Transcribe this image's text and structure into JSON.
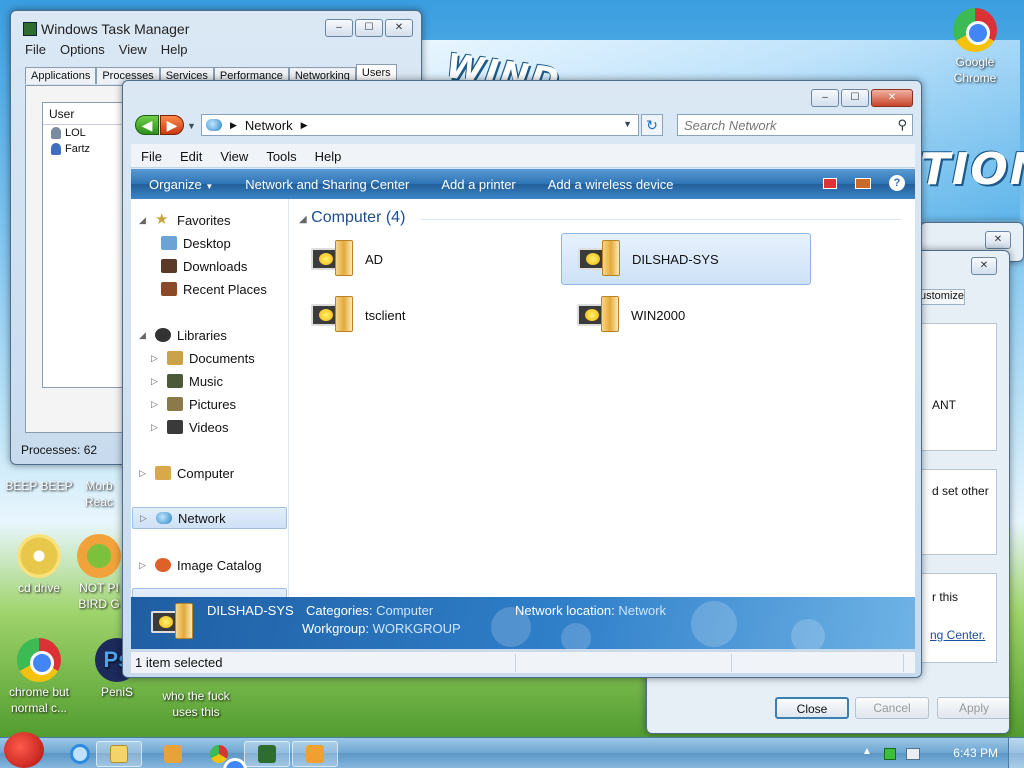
{
  "desktop": {
    "banner": {
      "word1": "WIND",
      "word2": "TION"
    },
    "icons": [
      {
        "label": "Google Chrome"
      },
      {
        "label": "BEEP BEEP"
      },
      {
        "label": "Morb Reac"
      },
      {
        "label": "cd drive"
      },
      {
        "label": "NOT PI BIRD G"
      },
      {
        "label": "chrome but normal c..."
      },
      {
        "label": "PeniS"
      },
      {
        "label": "who the fuck uses this"
      }
    ]
  },
  "taskmgr": {
    "title": "Windows Task Manager",
    "menu": [
      "File",
      "Options",
      "View",
      "Help"
    ],
    "tabs": [
      "Applications",
      "Processes",
      "Services",
      "Performance",
      "Networking",
      "Users"
    ],
    "column_user": "User",
    "users": [
      "LOL",
      "Fartz"
    ],
    "status": "Processes: 62"
  },
  "explorer": {
    "address": "Network",
    "search_placeholder": "Search Network",
    "menu": [
      "File",
      "Edit",
      "View",
      "Tools",
      "Help"
    ],
    "commands": [
      "Organize",
      "Network and Sharing Center",
      "Add a printer",
      "Add a wireless device"
    ],
    "nav": {
      "favorites": "Favorites",
      "desktop": "Desktop",
      "downloads": "Downloads",
      "recent": "Recent Places",
      "libraries": "Libraries",
      "documents": "Documents",
      "music": "Music",
      "pictures": "Pictures",
      "videos": "Videos",
      "computer": "Computer",
      "network": "Network",
      "image_catalog": "Image Catalog"
    },
    "group_title": "Computer (4)",
    "items": [
      "AD",
      "DILSHAD-SYS",
      "tsclient",
      "WIN2000"
    ],
    "details": {
      "name": "DILSHAD-SYS",
      "categories_label": "Categories:",
      "categories_value": "Computer",
      "workgroup_label": "Workgroup:",
      "workgroup_value": "WORKGROUP",
      "location_label": "Network location:",
      "location_value": "Network"
    },
    "status": "1 item selected"
  },
  "dialog": {
    "tab": "ustomize",
    "snippet1": "ANT",
    "snippet2": "d set other",
    "snippet3": "r this",
    "snippet4": "ng Center.",
    "close": "Close",
    "cancel": "Cancel",
    "apply": "Apply"
  },
  "taskbar": {
    "clock": "6:43 PM"
  }
}
